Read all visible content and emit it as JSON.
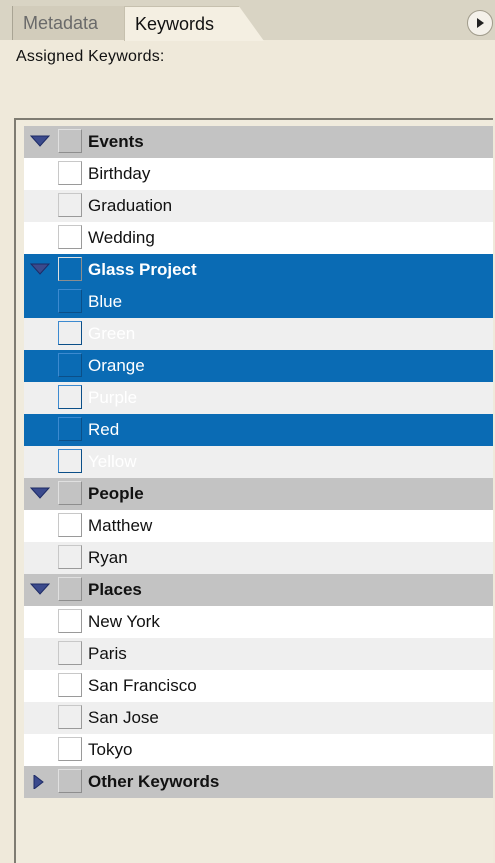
{
  "tabs": [
    {
      "label": "Metadata",
      "active": false
    },
    {
      "label": "Keywords",
      "active": true
    }
  ],
  "assigned_label": "Assigned Keywords:",
  "groups": [
    {
      "name": "Events",
      "expanded": true,
      "selected": false,
      "items": [
        "Birthday",
        "Graduation",
        "Wedding"
      ]
    },
    {
      "name": "Glass Project",
      "expanded": true,
      "selected": true,
      "items": [
        "Blue",
        "Green",
        "Orange",
        "Purple",
        "Red",
        "Yellow"
      ]
    },
    {
      "name": "People",
      "expanded": true,
      "selected": false,
      "items": [
        "Matthew",
        "Ryan"
      ]
    },
    {
      "name": "Places",
      "expanded": true,
      "selected": false,
      "items": [
        "New York",
        "Paris",
        "San Francisco",
        "San Jose",
        "Tokyo"
      ]
    },
    {
      "name": "Other Keywords",
      "expanded": false,
      "selected": false,
      "items": []
    }
  ],
  "colors": {
    "selection": "#0a6bb4",
    "category_row": "#c3c3c3",
    "triangle": "#3b4a8c"
  },
  "icons": {
    "expanded": "triangle-down-icon",
    "collapsed": "triangle-right-icon",
    "menu": "panel-menu-icon"
  }
}
